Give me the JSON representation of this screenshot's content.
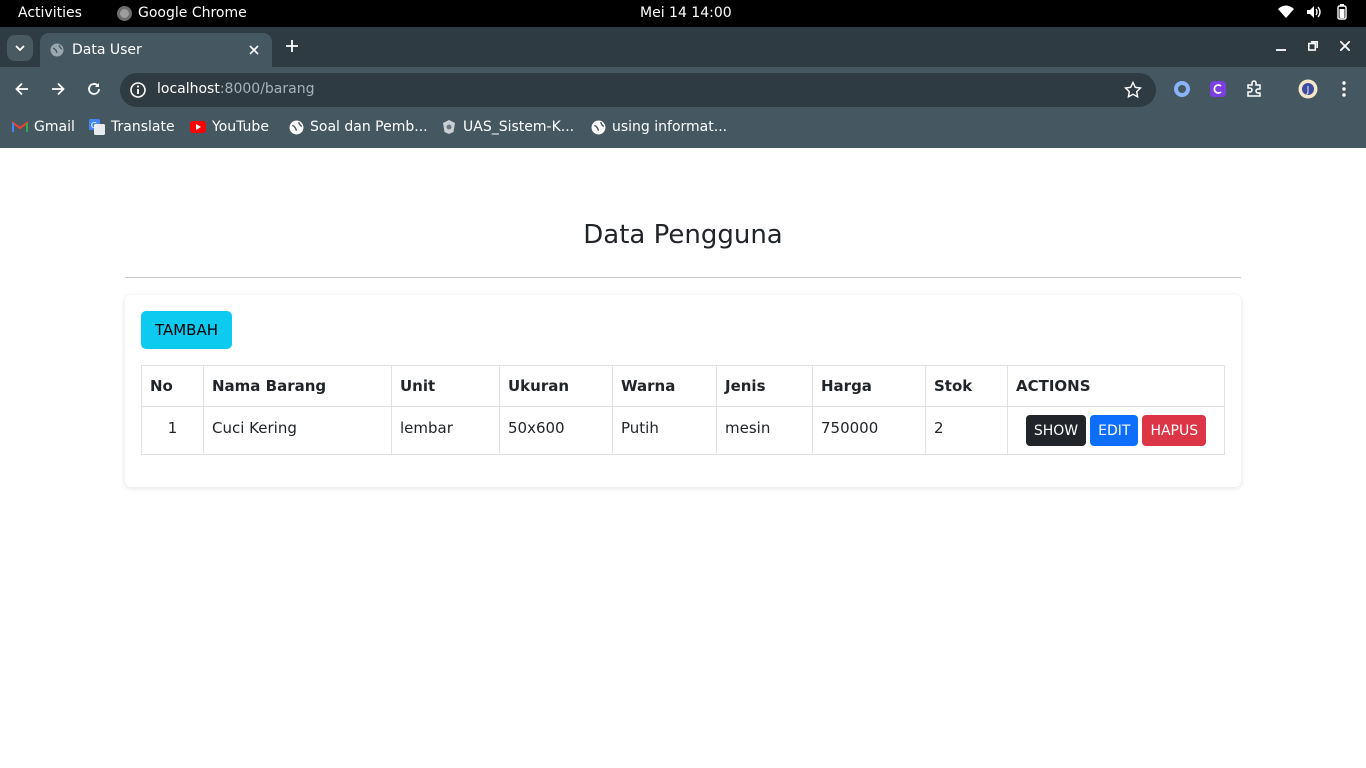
{
  "system": {
    "activities": "Activities",
    "app_name": "Google Chrome",
    "clock": "Mei 14  14:00"
  },
  "browser": {
    "tab_title": "Data User",
    "url_host": "localhost",
    "url_path": ":8000/barang",
    "bookmarks": [
      {
        "label": "Gmail",
        "icon": "gmail-icon"
      },
      {
        "label": "Translate",
        "icon": "translate-icon"
      },
      {
        "label": "YouTube",
        "icon": "youtube-icon"
      },
      {
        "label": "Soal dan Pemb...",
        "icon": "globe-icon"
      },
      {
        "label": "UAS_Sistem-K...",
        "icon": "university-icon"
      },
      {
        "label": "using informat...",
        "icon": "globe-icon"
      }
    ]
  },
  "page": {
    "heading": "Data Pengguna",
    "add_button": "TAMBAH",
    "table": {
      "headers": [
        "No",
        "Nama Barang",
        "Unit",
        "Ukuran",
        "Warna",
        "Jenis",
        "Harga",
        "Stok",
        "ACTIONS"
      ],
      "rows": [
        {
          "no": "1",
          "nama": "Cuci Kering",
          "unit": "lembar",
          "ukuran": "50x600",
          "warna": "Putih",
          "jenis": "mesin",
          "harga": "750000",
          "stok": "2"
        }
      ],
      "actions": {
        "show": "SHOW",
        "edit": "EDIT",
        "hapus": "HAPUS"
      }
    }
  },
  "colors": {
    "add": "#0dcaf0",
    "show": "#212529",
    "edit": "#0d6efd",
    "hapus": "#dc3545"
  }
}
